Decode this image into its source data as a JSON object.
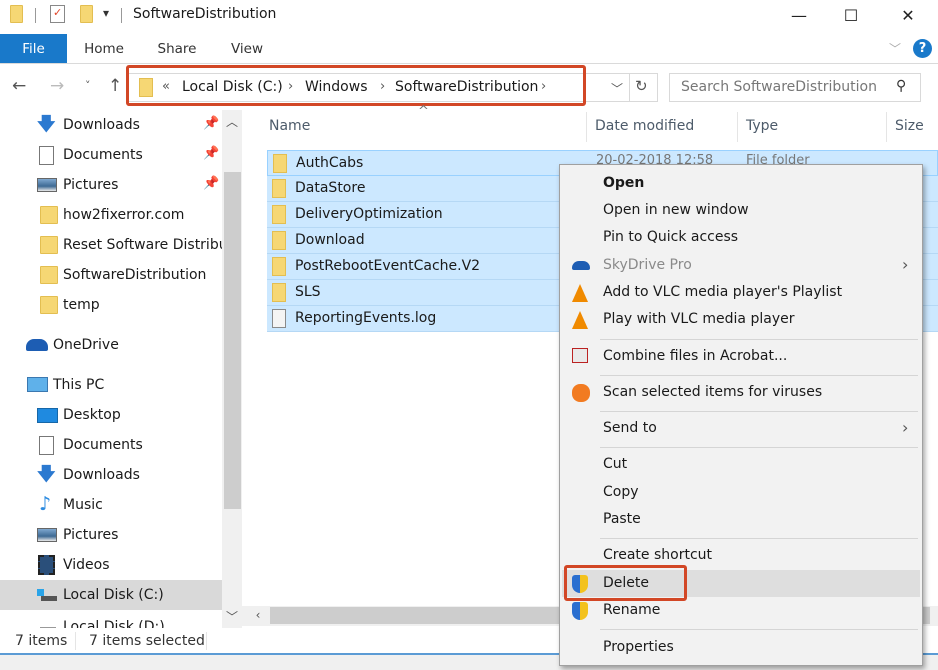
{
  "window": {
    "title": "SoftwareDistribution",
    "controls": {
      "minimize": "—",
      "maximize": "☐",
      "close": "✕"
    }
  },
  "ribbon": {
    "tabs": [
      {
        "label": "File",
        "active": true
      },
      {
        "label": "Home"
      },
      {
        "label": "Share"
      },
      {
        "label": "View"
      }
    ],
    "help": "?"
  },
  "address": {
    "overflow": "«",
    "breadcrumbs": [
      "Local Disk (C:)",
      "Windows",
      "SoftwareDistribution"
    ],
    "separator": "›",
    "search_placeholder": "Search SoftwareDistribution"
  },
  "navpane": {
    "quick_access": [
      {
        "label": "Downloads",
        "icon": "download-arrow-icon",
        "pinned": true
      },
      {
        "label": "Documents",
        "icon": "documents-icon",
        "pinned": true
      },
      {
        "label": "Pictures",
        "icon": "pictures-icon",
        "pinned": true
      },
      {
        "label": "how2fixerror.com",
        "icon": "folder-icon"
      },
      {
        "label": "Reset Software Distribut",
        "icon": "folder-icon"
      },
      {
        "label": "SoftwareDistribution",
        "icon": "folder-icon"
      },
      {
        "label": "temp",
        "icon": "folder-icon"
      }
    ],
    "onedrive": "OneDrive",
    "this_pc": "This PC",
    "pc_items": [
      {
        "label": "Desktop",
        "icon": "desktop-icon"
      },
      {
        "label": "Documents",
        "icon": "documents-icon"
      },
      {
        "label": "Downloads",
        "icon": "download-arrow-icon"
      },
      {
        "label": "Music",
        "icon": "music-icon"
      },
      {
        "label": "Pictures",
        "icon": "pictures-icon"
      },
      {
        "label": "Videos",
        "icon": "videos-icon"
      },
      {
        "label": "Local Disk (C:)",
        "icon": "drive-icon",
        "selected": true
      },
      {
        "label": "Local Disk (D:)",
        "icon": "drive-icon"
      }
    ]
  },
  "content": {
    "columns": [
      "Name",
      "Date modified",
      "Type",
      "Size"
    ],
    "sort_indicator": "^",
    "files": [
      {
        "name": "AuthCabs",
        "date": "20-02-2018 12:58",
        "type": "File folder",
        "kind": "folder"
      },
      {
        "name": "DataStore",
        "kind": "folder"
      },
      {
        "name": "DeliveryOptimization",
        "kind": "folder"
      },
      {
        "name": "Download",
        "kind": "folder"
      },
      {
        "name": "PostRebootEventCache.V2",
        "kind": "folder"
      },
      {
        "name": "SLS",
        "kind": "folder"
      },
      {
        "name": "ReportingEvents.log",
        "kind": "file"
      }
    ]
  },
  "status": {
    "items": "7 items",
    "selected": "7 items selected"
  },
  "context_menu": {
    "items": [
      {
        "label": "Open",
        "bold": true
      },
      {
        "label": "Open in new window"
      },
      {
        "label": "Pin to Quick access"
      },
      {
        "label": "SkyDrive Pro",
        "disabled": true,
        "submenu": true,
        "icon": "skydrive-icon"
      },
      {
        "label": "Add to VLC media player's Playlist",
        "icon": "vlc-icon"
      },
      {
        "label": "Play with VLC media player",
        "icon": "vlc-icon"
      },
      {
        "label": "Combine files in Acrobat...",
        "icon": "acrobat-icon"
      },
      {
        "label": "Scan selected items for viruses",
        "icon": "avast-icon"
      },
      {
        "label": "Send to",
        "submenu": true
      },
      {
        "label": "Cut"
      },
      {
        "label": "Copy"
      },
      {
        "label": "Paste"
      },
      {
        "label": "Create shortcut"
      },
      {
        "label": "Delete",
        "icon": "uac-shield-icon",
        "hover": true,
        "highlighted": true
      },
      {
        "label": "Rename",
        "icon": "uac-shield-icon"
      },
      {
        "label": "Properties"
      }
    ],
    "submenu_arrow": "›"
  },
  "colors": {
    "accent": "#1979ca",
    "selection": "#cce8ff",
    "highlight_box": "#d24726"
  }
}
